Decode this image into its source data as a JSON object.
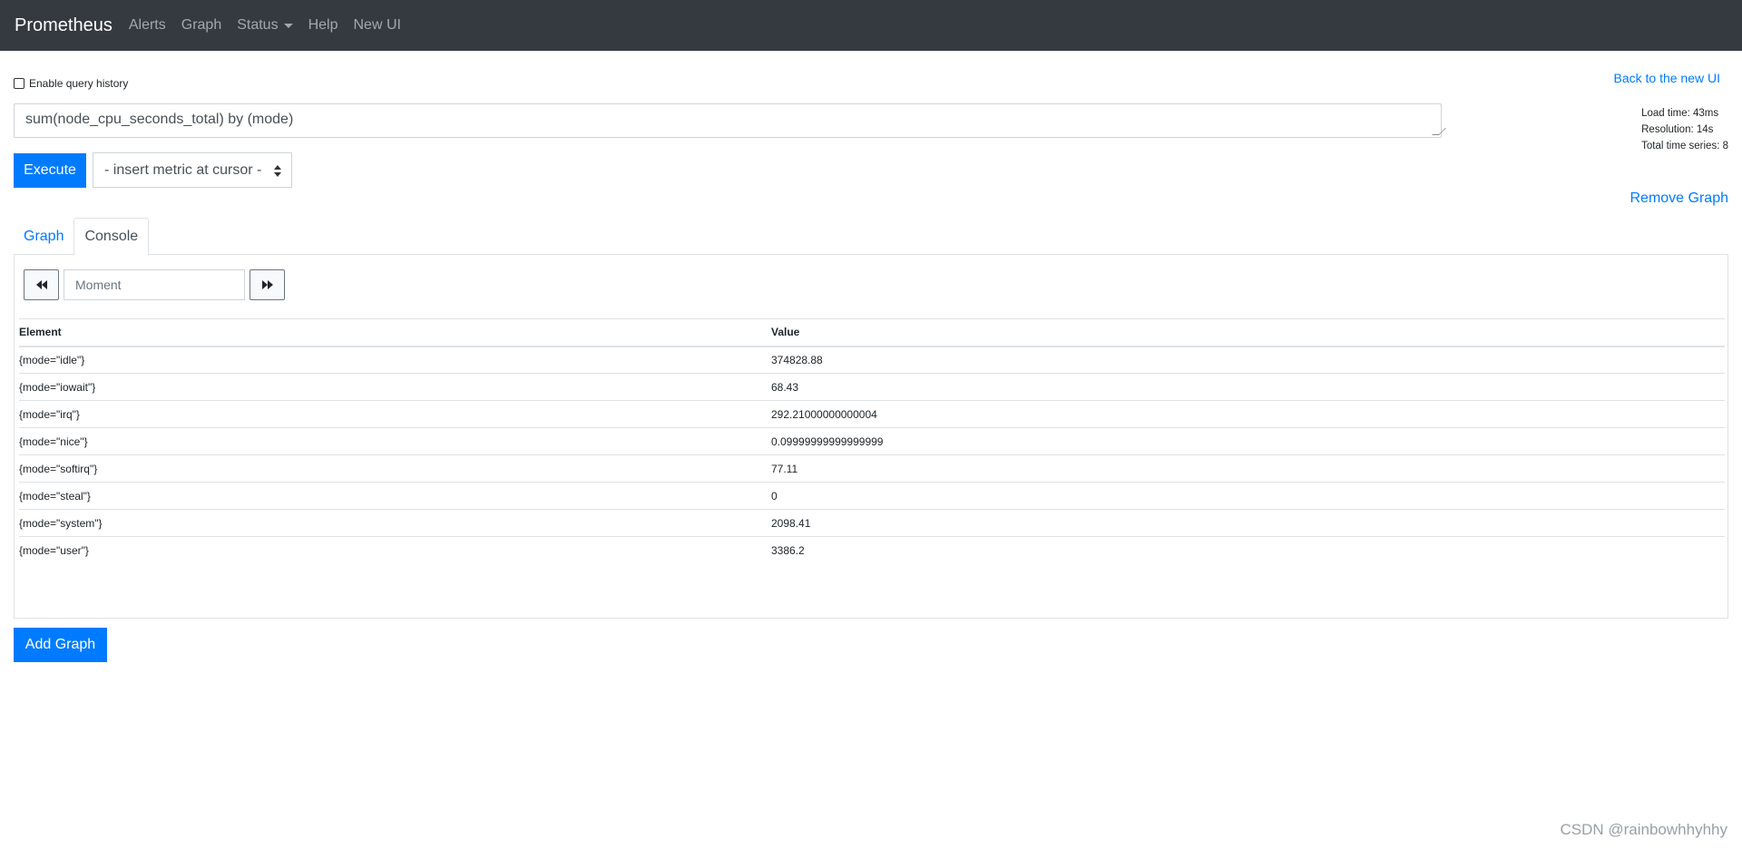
{
  "navbar": {
    "brand": "Prometheus",
    "links": [
      "Alerts",
      "Graph",
      "Status",
      "Help",
      "New UI"
    ]
  },
  "query_history_label": "Enable query history",
  "back_link": "Back to the new UI",
  "query": "sum(node_cpu_seconds_total) by (mode)",
  "stats": {
    "load_time": "Load time: 43ms",
    "resolution": "Resolution: 14s",
    "total_series": "Total time series: 8"
  },
  "execute_label": "Execute",
  "metric_select": "- insert metric at cursor -",
  "remove_graph": "Remove Graph",
  "tabs": [
    "Graph",
    "Console"
  ],
  "moment_placeholder": "Moment",
  "table": {
    "headers": [
      "Element",
      "Value"
    ],
    "rows": [
      [
        "{mode=\"idle\"}",
        "374828.88"
      ],
      [
        "{mode=\"iowait\"}",
        "68.43"
      ],
      [
        "{mode=\"irq\"}",
        "292.21000000000004"
      ],
      [
        "{mode=\"nice\"}",
        "0.09999999999999999"
      ],
      [
        "{mode=\"softirq\"}",
        "77.11"
      ],
      [
        "{mode=\"steal\"}",
        "0"
      ],
      [
        "{mode=\"system\"}",
        "2098.41"
      ],
      [
        "{mode=\"user\"}",
        "3386.2"
      ]
    ]
  },
  "add_graph": "Add Graph",
  "watermark": "CSDN @rainbowhhyhhy",
  "colors": {
    "navbar": "#343a40",
    "primary": "#007bff"
  }
}
